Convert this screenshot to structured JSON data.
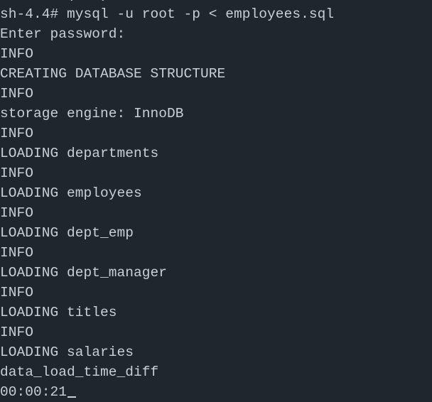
{
  "terminal": {
    "partial_top_line": "        (   )",
    "lines": [
      "sh-4.4# mysql -u root -p < employees.sql",
      "Enter password:",
      "INFO",
      "CREATING DATABASE STRUCTURE",
      "INFO",
      "storage engine: InnoDB",
      "INFO",
      "LOADING departments",
      "INFO",
      "LOADING employees",
      "INFO",
      "LOADING dept_emp",
      "INFO",
      "LOADING dept_manager",
      "INFO",
      "LOADING titles",
      "INFO",
      "LOADING salaries",
      "data_load_time_diff"
    ],
    "last_line": "00:00:21",
    "colors": {
      "background": "#1f262e",
      "text": "#c8cfd6"
    }
  }
}
